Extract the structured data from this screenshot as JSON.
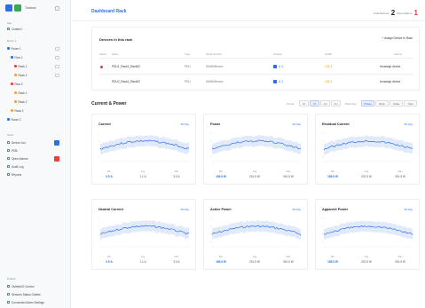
{
  "app": {
    "title": "Dashboard Rack",
    "brand": "Tradesk"
  },
  "sidebar": {
    "section_site": "Site",
    "site_item": "Cluster1",
    "section_rooms": "Room 1",
    "tree": [
      {
        "label": "Room 1",
        "color": "#2f6fe4"
      },
      {
        "label": "Row 1",
        "color": "#2f6fe4"
      },
      {
        "label": "Rack 1",
        "color": "#e8403d"
      },
      {
        "label": "Rack 2",
        "color": "#f2a23a"
      },
      {
        "label": "Row 2",
        "color": "#e8403d"
      },
      {
        "label": "Rack 1",
        "color": "#f2a23a"
      },
      {
        "label": "Rack 2",
        "color": "#f2a23a"
      },
      {
        "label": "Rack 3",
        "color": "#f2a23a"
      },
      {
        "label": "Room 2",
        "color": "#2f6fe4"
      }
    ],
    "section_tools": "Tools",
    "tools": [
      {
        "label": "Device List",
        "icon": "list-icon"
      },
      {
        "label": "PDB",
        "icon": "plug-icon"
      },
      {
        "label": "Open Alarms",
        "icon": "bell-icon"
      },
      {
        "label": "Audit Log",
        "icon": "log-icon"
      },
      {
        "label": "Reports",
        "icon": "report-icon"
      }
    ],
    "section_footer": "Default",
    "footer": [
      {
        "label": "Outlets/IO Control"
      },
      {
        "label": "Sensors Status Outlets"
      },
      {
        "label": "Connected Alarm Settings"
      }
    ]
  },
  "header": {
    "total_label": "Total Devices",
    "total_value": "2",
    "alarm_label": "Open Alarms",
    "alarm_value": "1"
  },
  "devices_panel": {
    "title": "Devices in this rack",
    "assign_label": "+  Assign Device to Rack",
    "columns": [
      "Status",
      "Name",
      "Type",
      "Serial Number",
      "Position",
      "Health",
      "Actions"
    ],
    "rows": [
      {
        "name": "PDU1_Rack1_Rack02",
        "type": "PDU",
        "serial": "SN4849xxxxx",
        "pos": "U 1",
        "health": "123.3",
        "action": "Unassign device",
        "alarm": true
      },
      {
        "name": "PDU2_Rack1_Rack02",
        "type": "PDU",
        "serial": "SN4849xxxxx",
        "pos": "U 2",
        "health": "123.3",
        "action": "Unassign device",
        "alarm": false
      }
    ]
  },
  "section": {
    "title": "Current & Power",
    "range_label": "Period",
    "ranges": [
      "1d",
      "7d",
      "1m",
      "3m"
    ],
    "group_label": "Data View",
    "groups": [
      "Phase",
      "Bank",
      "Outlet",
      "Total"
    ]
  },
  "cards": [
    {
      "title": "Current",
      "period": "30 Day",
      "stats": [
        {
          "label": "Min",
          "value": "0.5 A"
        },
        {
          "label": "Avg",
          "value": "1.1 A"
        },
        {
          "label": "Max",
          "value": "3.5 A"
        }
      ]
    },
    {
      "title": "Power",
      "period": "30 Day",
      "stats": [
        {
          "label": "Min",
          "value": "185.5 W"
        },
        {
          "label": "Avg",
          "value": "201.5 W"
        },
        {
          "label": "Max",
          "value": "301.5 W"
        }
      ]
    },
    {
      "title": "Residual Current",
      "period": "30 Day",
      "stats": [
        {
          "label": "Min",
          "value": "185.5 W"
        },
        {
          "label": "Avg",
          "value": "201.5 W"
        },
        {
          "label": "Max",
          "value": "301.5 W"
        }
      ]
    },
    {
      "title": "Neutral Current",
      "period": "30 Day",
      "stats": [
        {
          "label": "Min",
          "value": "0.5 A"
        },
        {
          "label": "Avg",
          "value": "1.1 A"
        },
        {
          "label": "Max",
          "value": "3.5 A"
        }
      ]
    },
    {
      "title": "Active Power",
      "period": "30 Day",
      "stats": [
        {
          "label": "Min",
          "value": "185.5 W"
        },
        {
          "label": "Avg",
          "value": "201.5 W"
        },
        {
          "label": "Max",
          "value": "301.5 W"
        }
      ]
    },
    {
      "title": "Apparent Power",
      "period": "30 Day",
      "stats": [
        {
          "label": "Min",
          "value": "185.5 W"
        },
        {
          "label": "Avg",
          "value": "201.5 W"
        },
        {
          "label": "Max",
          "value": "301.5 W"
        }
      ]
    }
  ],
  "colors": {
    "accent": "#2f6fe4",
    "alarm": "#e8403d",
    "warn": "#f2a23a",
    "line": "#2f6fe4",
    "band": "#c9d9f7"
  }
}
